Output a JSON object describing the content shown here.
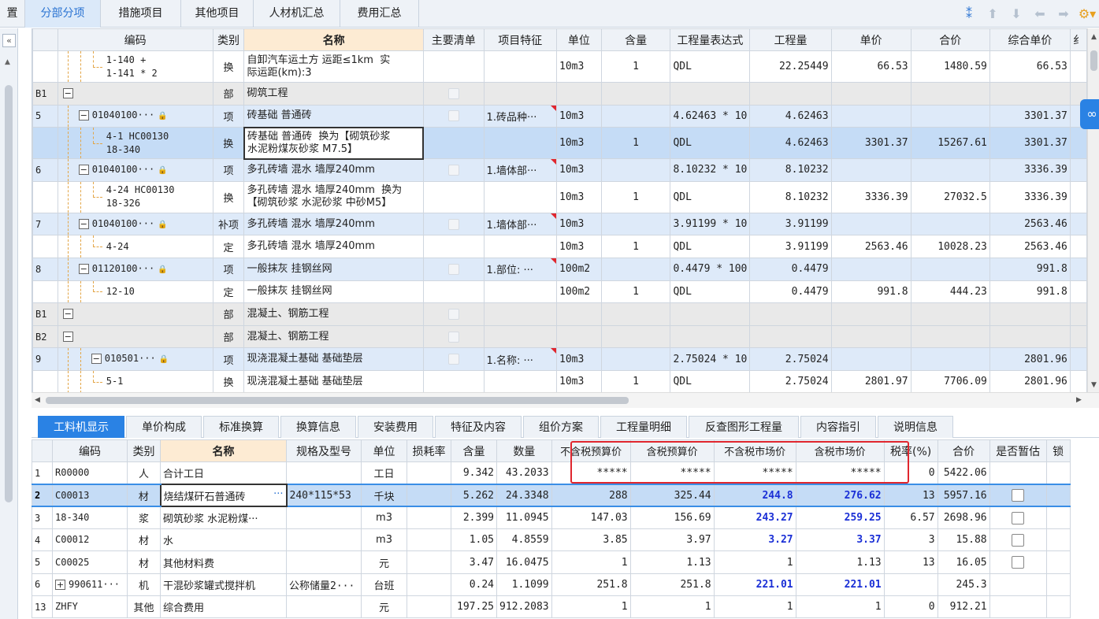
{
  "left_cut_label": "置",
  "top_tabs": [
    "分部分项",
    "措施项目",
    "其他项目",
    "人材机汇总",
    "费用汇总"
  ],
  "top_active": 0,
  "toolbar_icons": [
    "filter-icon",
    "move-up-icon",
    "move-down-icon",
    "move-left-icon",
    "move-right-icon",
    "settings-icon"
  ],
  "upper_headers": [
    "",
    "编码",
    "类别",
    "名称",
    "主要清单",
    "项目特征",
    "单位",
    "含量",
    "工程量表达式",
    "工程量",
    "单价",
    "合价",
    "综合单价",
    "纟"
  ],
  "upper_rows": [
    {
      "style": "normal",
      "no": "",
      "level": 3,
      "toggle": "",
      "lock": false,
      "code": "1-140 +\n1-141 * 2",
      "type": "换",
      "name": "自卸汽车运土方 运距≤1km  实\n际运距(km):3",
      "chk": false,
      "feature": "",
      "unit": "10m3",
      "qty": "1",
      "expr": "QDL",
      "amount": "22.25449",
      "price": "66.53",
      "total": "1480.59",
      "uprice": "66.53"
    },
    {
      "style": "group",
      "no": "B1",
      "level": 0,
      "toggle": "−",
      "lock": false,
      "code": "",
      "type": "部",
      "name": "砌筑工程",
      "chk": true,
      "feature": "",
      "unit": "",
      "qty": "",
      "expr": "",
      "amount": "",
      "price": "",
      "total": "",
      "uprice": ""
    },
    {
      "style": "item",
      "no": "5",
      "level": 1,
      "toggle": "−",
      "lock": true,
      "code": "01040100···",
      "type": "项",
      "name": "砖基础 普通砖",
      "chk": true,
      "feature": "1.砖品种···",
      "unit": "10m3",
      "qty": "",
      "expr": "4.62463 * 10",
      "amount": "4.62463",
      "price": "",
      "total": "",
      "uprice": "3301.37"
    },
    {
      "style": "sel",
      "no": "",
      "level": 3,
      "toggle": "",
      "lock": false,
      "code": "4-1 HC00130\n18-340",
      "type": "换",
      "name": "砖基础 普通砖  换为【砌筑砂浆\n水泥粉煤灰砂浆 M7.5】",
      "chk": false,
      "feature": "",
      "unit": "10m3",
      "qty": "1",
      "expr": "QDL",
      "amount": "4.62463",
      "price": "3301.37",
      "total": "15267.61",
      "uprice": "3301.37"
    },
    {
      "style": "item",
      "no": "6",
      "level": 1,
      "toggle": "−",
      "lock": true,
      "code": "01040100···",
      "type": "项",
      "name": "多孔砖墙 混水 墙厚240mm",
      "chk": true,
      "feature": "1.墙体部···",
      "unit": "10m3",
      "qty": "",
      "expr": "8.10232 * 10",
      "amount": "8.10232",
      "price": "",
      "total": "",
      "uprice": "3336.39"
    },
    {
      "style": "normal",
      "no": "",
      "level": 3,
      "toggle": "",
      "lock": false,
      "code": "4-24 HC00130\n18-326",
      "type": "换",
      "name": "多孔砖墙 混水 墙厚240mm  换为\n【砌筑砂浆 水泥砂浆 中砂M5】",
      "chk": false,
      "feature": "",
      "unit": "10m3",
      "qty": "1",
      "expr": "QDL",
      "amount": "8.10232",
      "price": "3336.39",
      "total": "27032.5",
      "uprice": "3336.39"
    },
    {
      "style": "item",
      "no": "7",
      "level": 1,
      "toggle": "−",
      "lock": true,
      "code": "01040100···",
      "type": "补项",
      "name": "多孔砖墙 混水 墙厚240mm",
      "chk": true,
      "feature": "1.墙体部···",
      "unit": "10m3",
      "qty": "",
      "expr": "3.91199 * 10",
      "amount": "3.91199",
      "price": "",
      "total": "",
      "uprice": "2563.46"
    },
    {
      "style": "normal",
      "no": "",
      "level": 3,
      "toggle": "",
      "lock": false,
      "code": "4-24",
      "type": "定",
      "name": "多孔砖墙 混水 墙厚240mm",
      "chk": false,
      "feature": "",
      "unit": "10m3",
      "qty": "1",
      "expr": "QDL",
      "amount": "3.91199",
      "price": "2563.46",
      "total": "10028.23",
      "uprice": "2563.46"
    },
    {
      "style": "item",
      "no": "8",
      "level": 1,
      "toggle": "−",
      "lock": true,
      "code": "01120100···",
      "type": "项",
      "name": "一般抹灰 挂钢丝网",
      "chk": true,
      "feature": "1.部位: ···",
      "unit": "100m2",
      "qty": "",
      "expr": "0.4479 * 100",
      "amount": "0.4479",
      "price": "",
      "total": "",
      "uprice": "991.8"
    },
    {
      "style": "normal",
      "no": "",
      "level": 3,
      "toggle": "",
      "lock": false,
      "code": "12-10",
      "type": "定",
      "name": "一般抹灰 挂钢丝网",
      "chk": false,
      "feature": "",
      "unit": "100m2",
      "qty": "1",
      "expr": "QDL",
      "amount": "0.4479",
      "price": "991.8",
      "total": "444.23",
      "uprice": "991.8"
    },
    {
      "style": "group",
      "no": "B1",
      "level": 0,
      "toggle": "−",
      "lock": false,
      "code": "",
      "type": "部",
      "name": "混凝土、钢筋工程",
      "chk": true,
      "feature": "",
      "unit": "",
      "qty": "",
      "expr": "",
      "amount": "",
      "price": "",
      "total": "",
      "uprice": ""
    },
    {
      "style": "group",
      "no": "B2",
      "level": 0,
      "toggle": "−",
      "lock": false,
      "code": "",
      "type": "部",
      "name": "混凝土、钢筋工程",
      "chk": true,
      "feature": "",
      "unit": "",
      "qty": "",
      "expr": "",
      "amount": "",
      "price": "",
      "total": "",
      "uprice": ""
    },
    {
      "style": "item",
      "no": "9",
      "level": 2,
      "toggle": "−",
      "lock": true,
      "code": "010501···",
      "type": "项",
      "name": "现浇混凝土基础 基础垫层",
      "chk": true,
      "feature": "1.名称: ···",
      "unit": "10m3",
      "qty": "",
      "expr": "2.75024 * 10",
      "amount": "2.75024",
      "price": "",
      "total": "",
      "uprice": "2801.96"
    },
    {
      "style": "normal",
      "no": "",
      "level": 3,
      "toggle": "",
      "lock": false,
      "code": "5-1",
      "type": "换",
      "name": "现浇混凝土基础 基础垫层",
      "chk": false,
      "feature": "",
      "unit": "10m3",
      "qty": "1",
      "expr": "QDL",
      "amount": "2.75024",
      "price": "2801.97",
      "total": "7706.09",
      "uprice": "2801.96"
    }
  ],
  "lower_tabs": [
    "工料机显示",
    "单价构成",
    "标准换算",
    "换算信息",
    "安装费用",
    "特征及内容",
    "组价方案",
    "工程量明细",
    "反查图形工程量",
    "内容指引",
    "说明信息"
  ],
  "lower_active": 0,
  "lower_headers": [
    "",
    "编码",
    "类别",
    "名称",
    "规格及型号",
    "单位",
    "损耗率",
    "含量",
    "数量",
    "不含税预算价",
    "含税预算价",
    "不含税市场价",
    "含税市场价",
    "税率(%)",
    "合价",
    "是否暂估",
    "锁"
  ],
  "lower_rows": [
    {
      "no": "1",
      "toggle": "",
      "code": "R00000",
      "type": "人",
      "name": "合计工日",
      "spec": "",
      "unit": "工日",
      "loss": "",
      "content": "9.342",
      "qty": "43.2033",
      "p1": "*****",
      "p2": "*****",
      "p3": "*****",
      "p4": "*****",
      "tax": "0",
      "total": "5422.06",
      "chk": false,
      "sel": false,
      "blue": false
    },
    {
      "no": "2",
      "toggle": "",
      "code": "C00013",
      "type": "材",
      "name": "烧结煤矸石普通砖",
      "spec": "240*115*53",
      "unit": "千块",
      "loss": "",
      "content": "5.262",
      "qty": "24.3348",
      "p1": "288",
      "p2": "325.44",
      "p3": "244.8",
      "p4": "276.62",
      "tax": "13",
      "total": "5957.16",
      "chk": true,
      "sel": true,
      "blue": true
    },
    {
      "no": "3",
      "toggle": "",
      "code": "18-340",
      "type": "浆",
      "name": "砌筑砂浆 水泥粉煤···",
      "spec": "",
      "unit": "m3",
      "loss": "",
      "content": "2.399",
      "qty": "11.0945",
      "p1": "147.03",
      "p2": "156.69",
      "p3": "243.27",
      "p4": "259.25",
      "tax": "6.57",
      "total": "2698.96",
      "chk": true,
      "sel": false,
      "blue": true
    },
    {
      "no": "4",
      "toggle": "",
      "code": "C00012",
      "type": "材",
      "name": "水",
      "spec": "",
      "unit": "m3",
      "loss": "",
      "content": "1.05",
      "qty": "4.8559",
      "p1": "3.85",
      "p2": "3.97",
      "p3": "3.27",
      "p4": "3.37",
      "tax": "3",
      "total": "15.88",
      "chk": true,
      "sel": false,
      "blue": true
    },
    {
      "no": "5",
      "toggle": "",
      "code": "C00025",
      "type": "材",
      "name": "其他材料费",
      "spec": "",
      "unit": "元",
      "loss": "",
      "content": "3.47",
      "qty": "16.0475",
      "p1": "1",
      "p2": "1.13",
      "p3": "1",
      "p4": "1.13",
      "tax": "13",
      "total": "16.05",
      "chk": true,
      "sel": false,
      "blue": false
    },
    {
      "no": "6",
      "toggle": "+",
      "code": "990611···",
      "type": "机",
      "name": "干混砂浆罐式搅拌机",
      "spec": "公称储量2···",
      "unit": "台班",
      "loss": "",
      "content": "0.24",
      "qty": "1.1099",
      "p1": "251.8",
      "p2": "251.8",
      "p3": "221.01",
      "p4": "221.01",
      "tax": "",
      "total": "245.3",
      "chk": false,
      "sel": false,
      "blue": true
    },
    {
      "no": "13",
      "toggle": "",
      "code": "ZHFY",
      "type": "其他",
      "name": "综合费用",
      "spec": "",
      "unit": "元",
      "loss": "",
      "content": "197.25",
      "qty": "912.2083",
      "p1": "1",
      "p2": "1",
      "p3": "1",
      "p4": "1",
      "tax": "0",
      "total": "912.21",
      "chk": false,
      "sel": false,
      "blue": false
    }
  ],
  "colors": {
    "accent": "#2a82e4",
    "highlight_box": "#e0262e",
    "selected_row": "#c5dcf6",
    "item_row": "#deeaf9",
    "group_row": "#e9e9e9",
    "blue_value": "#1a2fd6"
  }
}
